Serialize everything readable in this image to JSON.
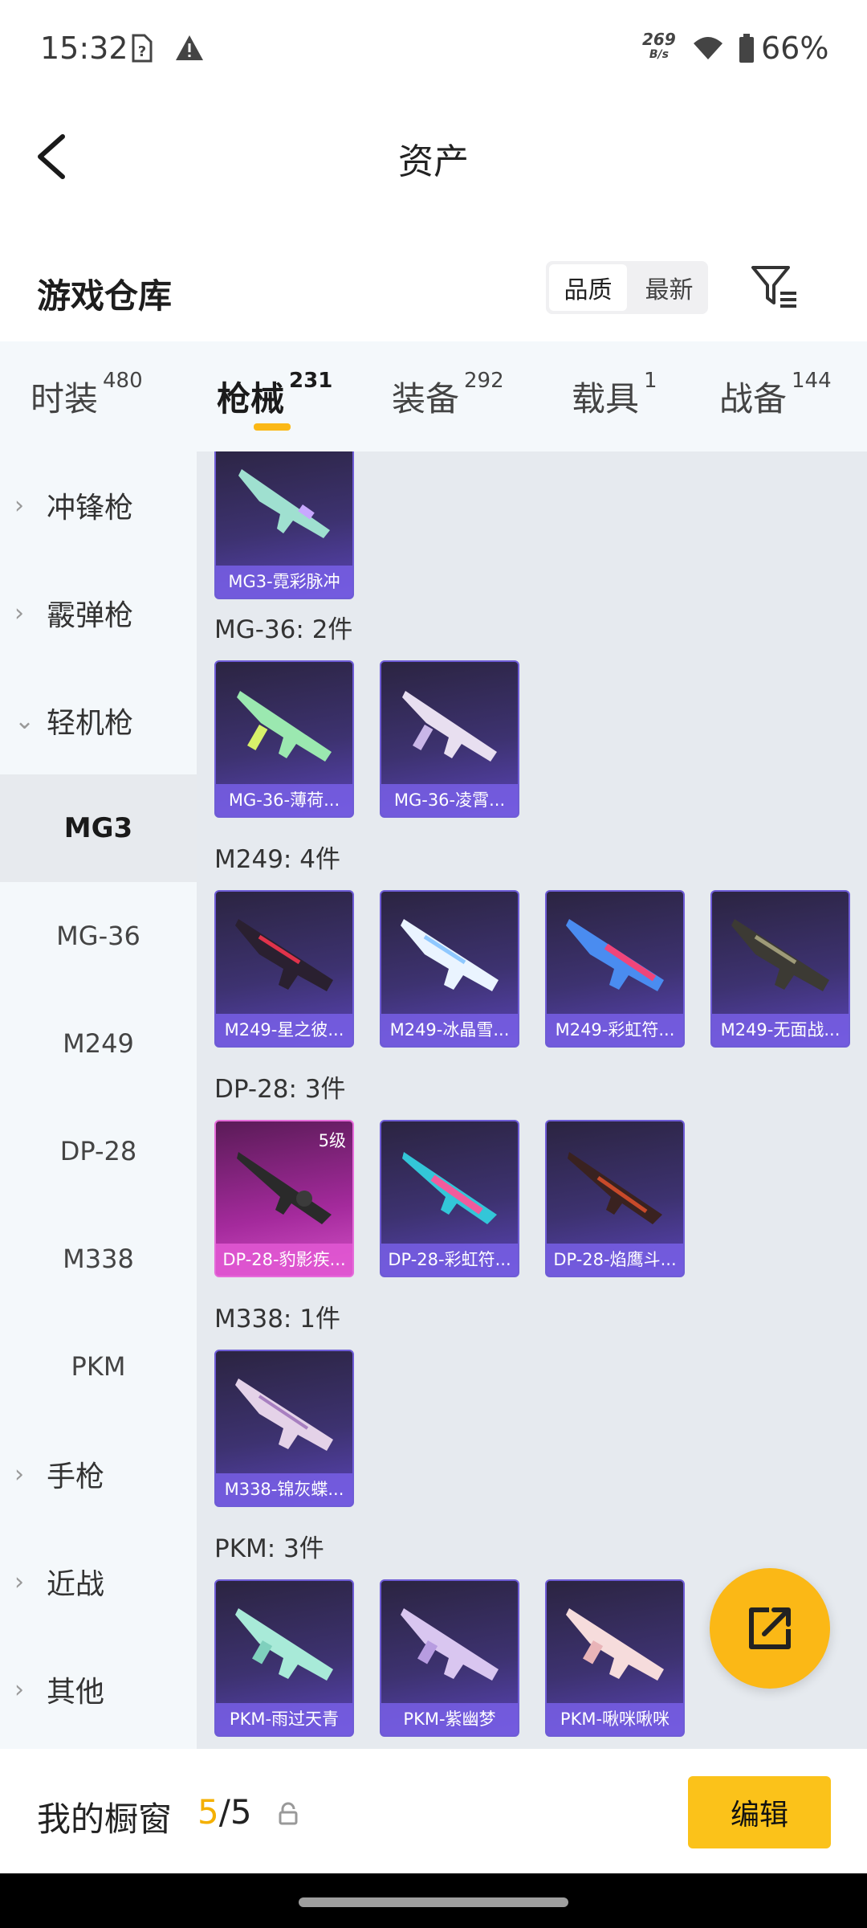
{
  "status_bar": {
    "time": "15:32",
    "net_speed_value": "269",
    "net_speed_unit": "B/s",
    "battery": "66%"
  },
  "header": {
    "title": "资产"
  },
  "section": {
    "title": "游戏仓库",
    "sort_options": [
      "品质",
      "最新"
    ],
    "sort_active": "品质"
  },
  "tabs": [
    {
      "label": "时装",
      "count": "480"
    },
    {
      "label": "枪械",
      "count": "231"
    },
    {
      "label": "装备",
      "count": "292"
    },
    {
      "label": "载具",
      "count": "1"
    },
    {
      "label": "战备",
      "count": "144"
    }
  ],
  "sidebar": {
    "categories": [
      "冲锋枪",
      "霰弹枪",
      "轻机枪",
      "手枪",
      "近战",
      "其他"
    ],
    "subcategories": [
      "MG3",
      "MG-36",
      "M249",
      "DP-28",
      "M338",
      "PKM"
    ],
    "selected": "MG3"
  },
  "groups": [
    {
      "title": "",
      "items": [
        {
          "label": "MG3-霓彩脉冲"
        }
      ]
    },
    {
      "title": "MG-36: 2件",
      "items": [
        {
          "label": "MG-36-薄荷..."
        },
        {
          "label": "MG-36-凌霄..."
        }
      ]
    },
    {
      "title": "M249: 4件",
      "items": [
        {
          "label": "M249-星之彼..."
        },
        {
          "label": "M249-冰晶雪..."
        },
        {
          "label": "M249-彩虹符..."
        },
        {
          "label": "M249-无面战..."
        }
      ]
    },
    {
      "title": "DP-28: 3件",
      "items": [
        {
          "label": "DP-28-豹影疾...",
          "level": "5级"
        },
        {
          "label": "DP-28-彩虹符..."
        },
        {
          "label": "DP-28-焰鹰斗..."
        }
      ]
    },
    {
      "title": "M338: 1件",
      "items": [
        {
          "label": "M338-锦灰蝶..."
        }
      ]
    },
    {
      "title": "PKM: 3件",
      "items": [
        {
          "label": "PKM-雨过天青"
        },
        {
          "label": "PKM-紫幽梦"
        },
        {
          "label": "PKM-啾咪啾咪"
        }
      ]
    }
  ],
  "bottom_bar": {
    "title": "我的橱窗",
    "current": "5",
    "separator_total": "/5",
    "edit_label": "编辑"
  },
  "colors": {
    "accent": "#fbb816",
    "card_purple": "#3d3270",
    "card_pink": "#a42a9c"
  }
}
